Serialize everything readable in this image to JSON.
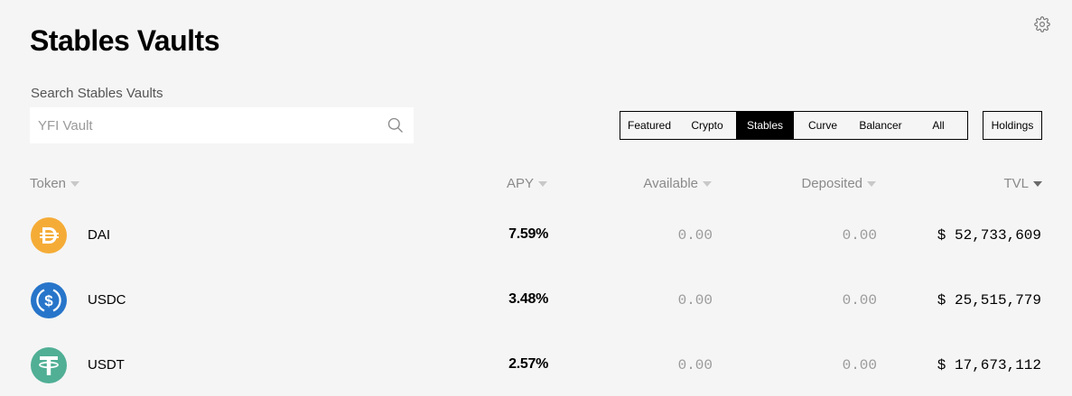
{
  "page": {
    "title": "Stables Vaults"
  },
  "search": {
    "label": "Search Stables Vaults",
    "placeholder": "YFI Vault"
  },
  "filters": {
    "tabs": [
      "Featured",
      "Crypto",
      "Stables",
      "Curve",
      "Balancer",
      "All"
    ],
    "active": "Stables",
    "holdings_label": "Holdings"
  },
  "table": {
    "headers": {
      "token": "Token",
      "apy": "APY",
      "available": "Available",
      "deposited": "Deposited",
      "tvl": "TVL"
    },
    "rows": [
      {
        "token": "DAI",
        "icon": "dai-icon",
        "color": "#F5AC37",
        "apy": "7.59%",
        "available": "0.00",
        "deposited": "0.00",
        "tvl": "$ 52,733,609"
      },
      {
        "token": "USDC",
        "icon": "usdc-icon",
        "color": "#2775CA",
        "apy": "3.48%",
        "available": "0.00",
        "deposited": "0.00",
        "tvl": "$ 25,515,779"
      },
      {
        "token": "USDT",
        "icon": "usdt-icon",
        "color": "#50AF95",
        "apy": "2.57%",
        "available": "0.00",
        "deposited": "0.00",
        "tvl": "$ 17,673,112"
      }
    ]
  }
}
